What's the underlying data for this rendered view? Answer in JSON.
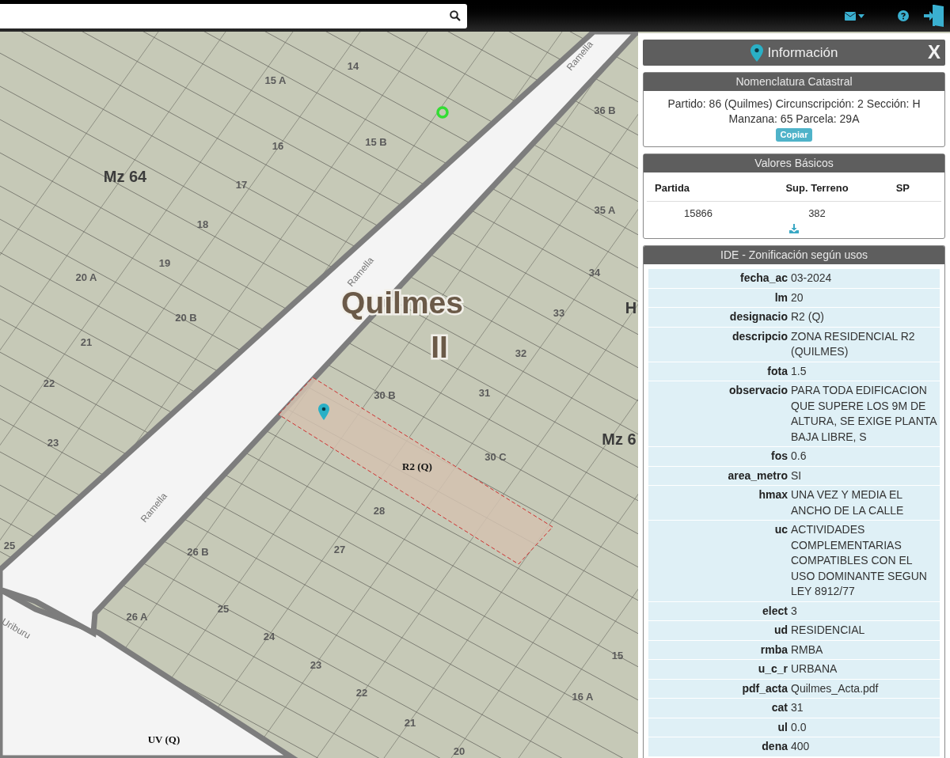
{
  "map": {
    "labels": [
      {
        "kind": "parcel",
        "text": "14"
      },
      {
        "kind": "street",
        "text": "Ramella"
      },
      {
        "kind": "parcel",
        "text": "15 A"
      },
      {
        "kind": "parcel",
        "text": "36 B"
      },
      {
        "kind": "parcel",
        "text": "16"
      },
      {
        "kind": "parcel",
        "text": "15 B"
      },
      {
        "kind": "block",
        "text": "Mz 64"
      },
      {
        "kind": "parcel",
        "text": "17"
      },
      {
        "kind": "parcel",
        "text": "35 A"
      },
      {
        "kind": "parcel",
        "text": "18"
      },
      {
        "kind": "parcel",
        "text": "19"
      },
      {
        "kind": "parcel",
        "text": "20 A"
      },
      {
        "kind": "street",
        "text": "Ramella"
      },
      {
        "kind": "parcel",
        "text": "34"
      },
      {
        "kind": "parcel",
        "text": "20 B"
      },
      {
        "kind": "big",
        "text": "Quilmes"
      },
      {
        "kind": "parcel",
        "text": "33"
      },
      {
        "kind": "block",
        "text": "H"
      },
      {
        "kind": "parcel",
        "text": "21"
      },
      {
        "kind": "big",
        "text": "II"
      },
      {
        "kind": "parcel",
        "text": "32"
      },
      {
        "kind": "parcel",
        "text": "22"
      },
      {
        "kind": "parcel",
        "text": "30 B"
      },
      {
        "kind": "parcel",
        "text": "31"
      },
      {
        "kind": "parcel",
        "text": "23"
      },
      {
        "kind": "block",
        "text": "Mz 6"
      },
      {
        "kind": "zone",
        "text": "R2 (Q)"
      },
      {
        "kind": "parcel",
        "text": "30 C"
      },
      {
        "kind": "street",
        "text": "Ramella"
      },
      {
        "kind": "parcel",
        "text": "28"
      },
      {
        "kind": "parcel",
        "text": "25"
      },
      {
        "kind": "parcel",
        "text": "26 B"
      },
      {
        "kind": "parcel",
        "text": "27"
      },
      {
        "kind": "parcel",
        "text": "26 A"
      },
      {
        "kind": "parcel",
        "text": "25"
      },
      {
        "kind": "street",
        "text": "Uriburu"
      },
      {
        "kind": "parcel",
        "text": "24"
      },
      {
        "kind": "parcel",
        "text": "23"
      },
      {
        "kind": "parcel",
        "text": "15"
      },
      {
        "kind": "parcel",
        "text": "22"
      },
      {
        "kind": "parcel",
        "text": "16 A"
      },
      {
        "kind": "parcel",
        "text": "21"
      },
      {
        "kind": "zone",
        "text": "UV (Q)"
      },
      {
        "kind": "parcel",
        "text": "20"
      }
    ]
  },
  "panel": {
    "title": "Información",
    "close": "X",
    "nomenclatura": {
      "title": "Nomenclatura Catastral",
      "text": "Partido: 86 (Quilmes) Circunscripción: 2 Sección: H Manzana: 65 Parcela: 29A",
      "button": "Copiar"
    },
    "valores": {
      "title": "Valores Básicos",
      "columns": [
        "Partida",
        "Sup. Terreno",
        "SP"
      ],
      "row": [
        "15866",
        "382"
      ]
    },
    "zonificacion": {
      "title": "IDE - Zonificación según usos",
      "rows": [
        {
          "label": "fecha_ac",
          "value": "03-2024"
        },
        {
          "label": "lm",
          "value": "20"
        },
        {
          "label": "designacio",
          "value": "R2 (Q)"
        },
        {
          "label": "descripcio",
          "value": "ZONA RESIDENCIAL R2 (QUILMES)"
        },
        {
          "label": "fota",
          "value": "1.5"
        },
        {
          "label": "observacio",
          "value": "PARA TODA EDIFICACION QUE SUPERE LOS 9M DE ALTURA, SE EXIGE PLANTA BAJA LIBRE, S"
        },
        {
          "label": "fos",
          "value": "0.6"
        },
        {
          "label": "area_metro",
          "value": "SI"
        },
        {
          "label": "hmax",
          "value": "UNA VEZ Y MEDIA EL ANCHO DE LA CALLE"
        },
        {
          "label": "uc",
          "value": "ACTIVIDADES COMPLEMENTARIAS COMPATIBLES CON EL USO DOMINANTE SEGUN LEY 8912/77"
        },
        {
          "label": "elect",
          "value": "3"
        },
        {
          "label": "ud",
          "value": "RESIDENCIAL"
        },
        {
          "label": "rmba",
          "value": "RMBA"
        },
        {
          "label": "u_c_r",
          "value": "URBANA"
        },
        {
          "label": "pdf_acta",
          "value": "Quilmes_Acta.pdf"
        },
        {
          "label": "cat",
          "value": "31"
        },
        {
          "label": "ul",
          "value": "0.0"
        },
        {
          "label": "dena",
          "value": "400"
        }
      ]
    }
  }
}
